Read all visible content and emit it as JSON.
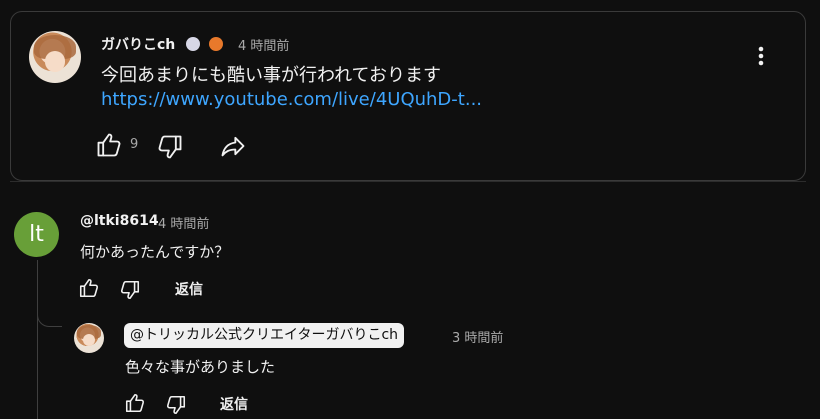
{
  "top_comment": {
    "author": "ガバりこch",
    "time": "4 時間前",
    "text": "今回あまりにも酷い事が行われております",
    "link": "https://www.youtube.com/live/4UQuhD-t...",
    "like_count": "9",
    "icons": [
      "like-icon",
      "dislike-icon",
      "share-icon",
      "more-vert-icon"
    ]
  },
  "comment": {
    "avatar_letter": "lt",
    "author": "@ltki8614",
    "time": "4 時間前",
    "text": "何かあったんですか？",
    "reply_label": "返信"
  },
  "reply": {
    "author": "@トリッカル公式クリエイターガバりこch",
    "time": "3 時間前",
    "text": "色々な事がありました",
    "reply_label": "返信"
  },
  "colors": {
    "background": "#0f0f0f",
    "link": "#3ea6ff",
    "avatar_green": "#689f38",
    "secondary_text": "#aaaaaa"
  }
}
